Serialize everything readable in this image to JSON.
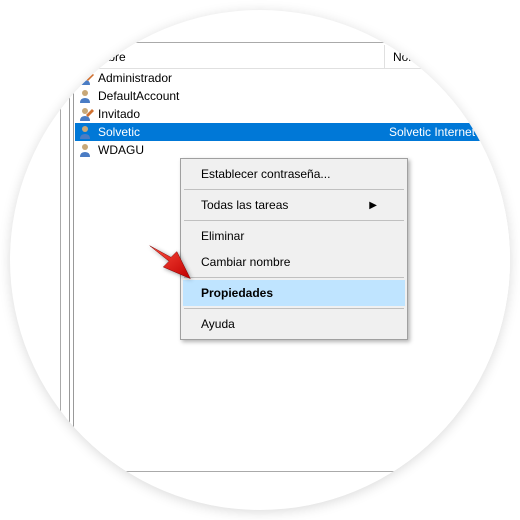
{
  "columns": {
    "name": "Nombre",
    "fullname": "Nombre co"
  },
  "users": [
    {
      "name": "Administrador",
      "full": ""
    },
    {
      "name": "DefaultAccount",
      "full": ""
    },
    {
      "name": "Invitado",
      "full": ""
    },
    {
      "name": "Solvetic",
      "full": "Solvetic Internet"
    },
    {
      "name": "WDAGU",
      "full": ""
    }
  ],
  "menu": {
    "setPassword": "Establecer contraseña...",
    "allTasks": "Todas las tareas",
    "delete": "Eliminar",
    "rename": "Cambiar nombre",
    "properties": "Propiedades",
    "help": "Ayuda"
  }
}
